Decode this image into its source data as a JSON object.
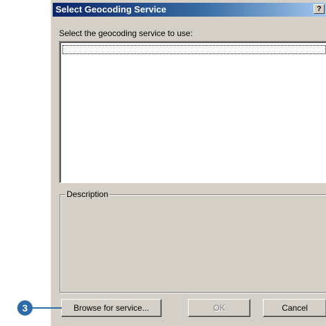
{
  "dialog": {
    "title": "Select Geocoding Service",
    "help_label": "?",
    "close_label": "×",
    "prompt": "Select the geocoding service to use:",
    "description_label": "Description",
    "buttons": {
      "browse": "Browse for service...",
      "ok": "OK",
      "cancel": "Cancel"
    }
  },
  "callout": {
    "number": "3"
  },
  "colors": {
    "titlebar_start": "#0a246a",
    "titlebar_end": "#a6caf0",
    "dialog_face": "#d4d0c8",
    "callout": "#2d6ca8"
  }
}
